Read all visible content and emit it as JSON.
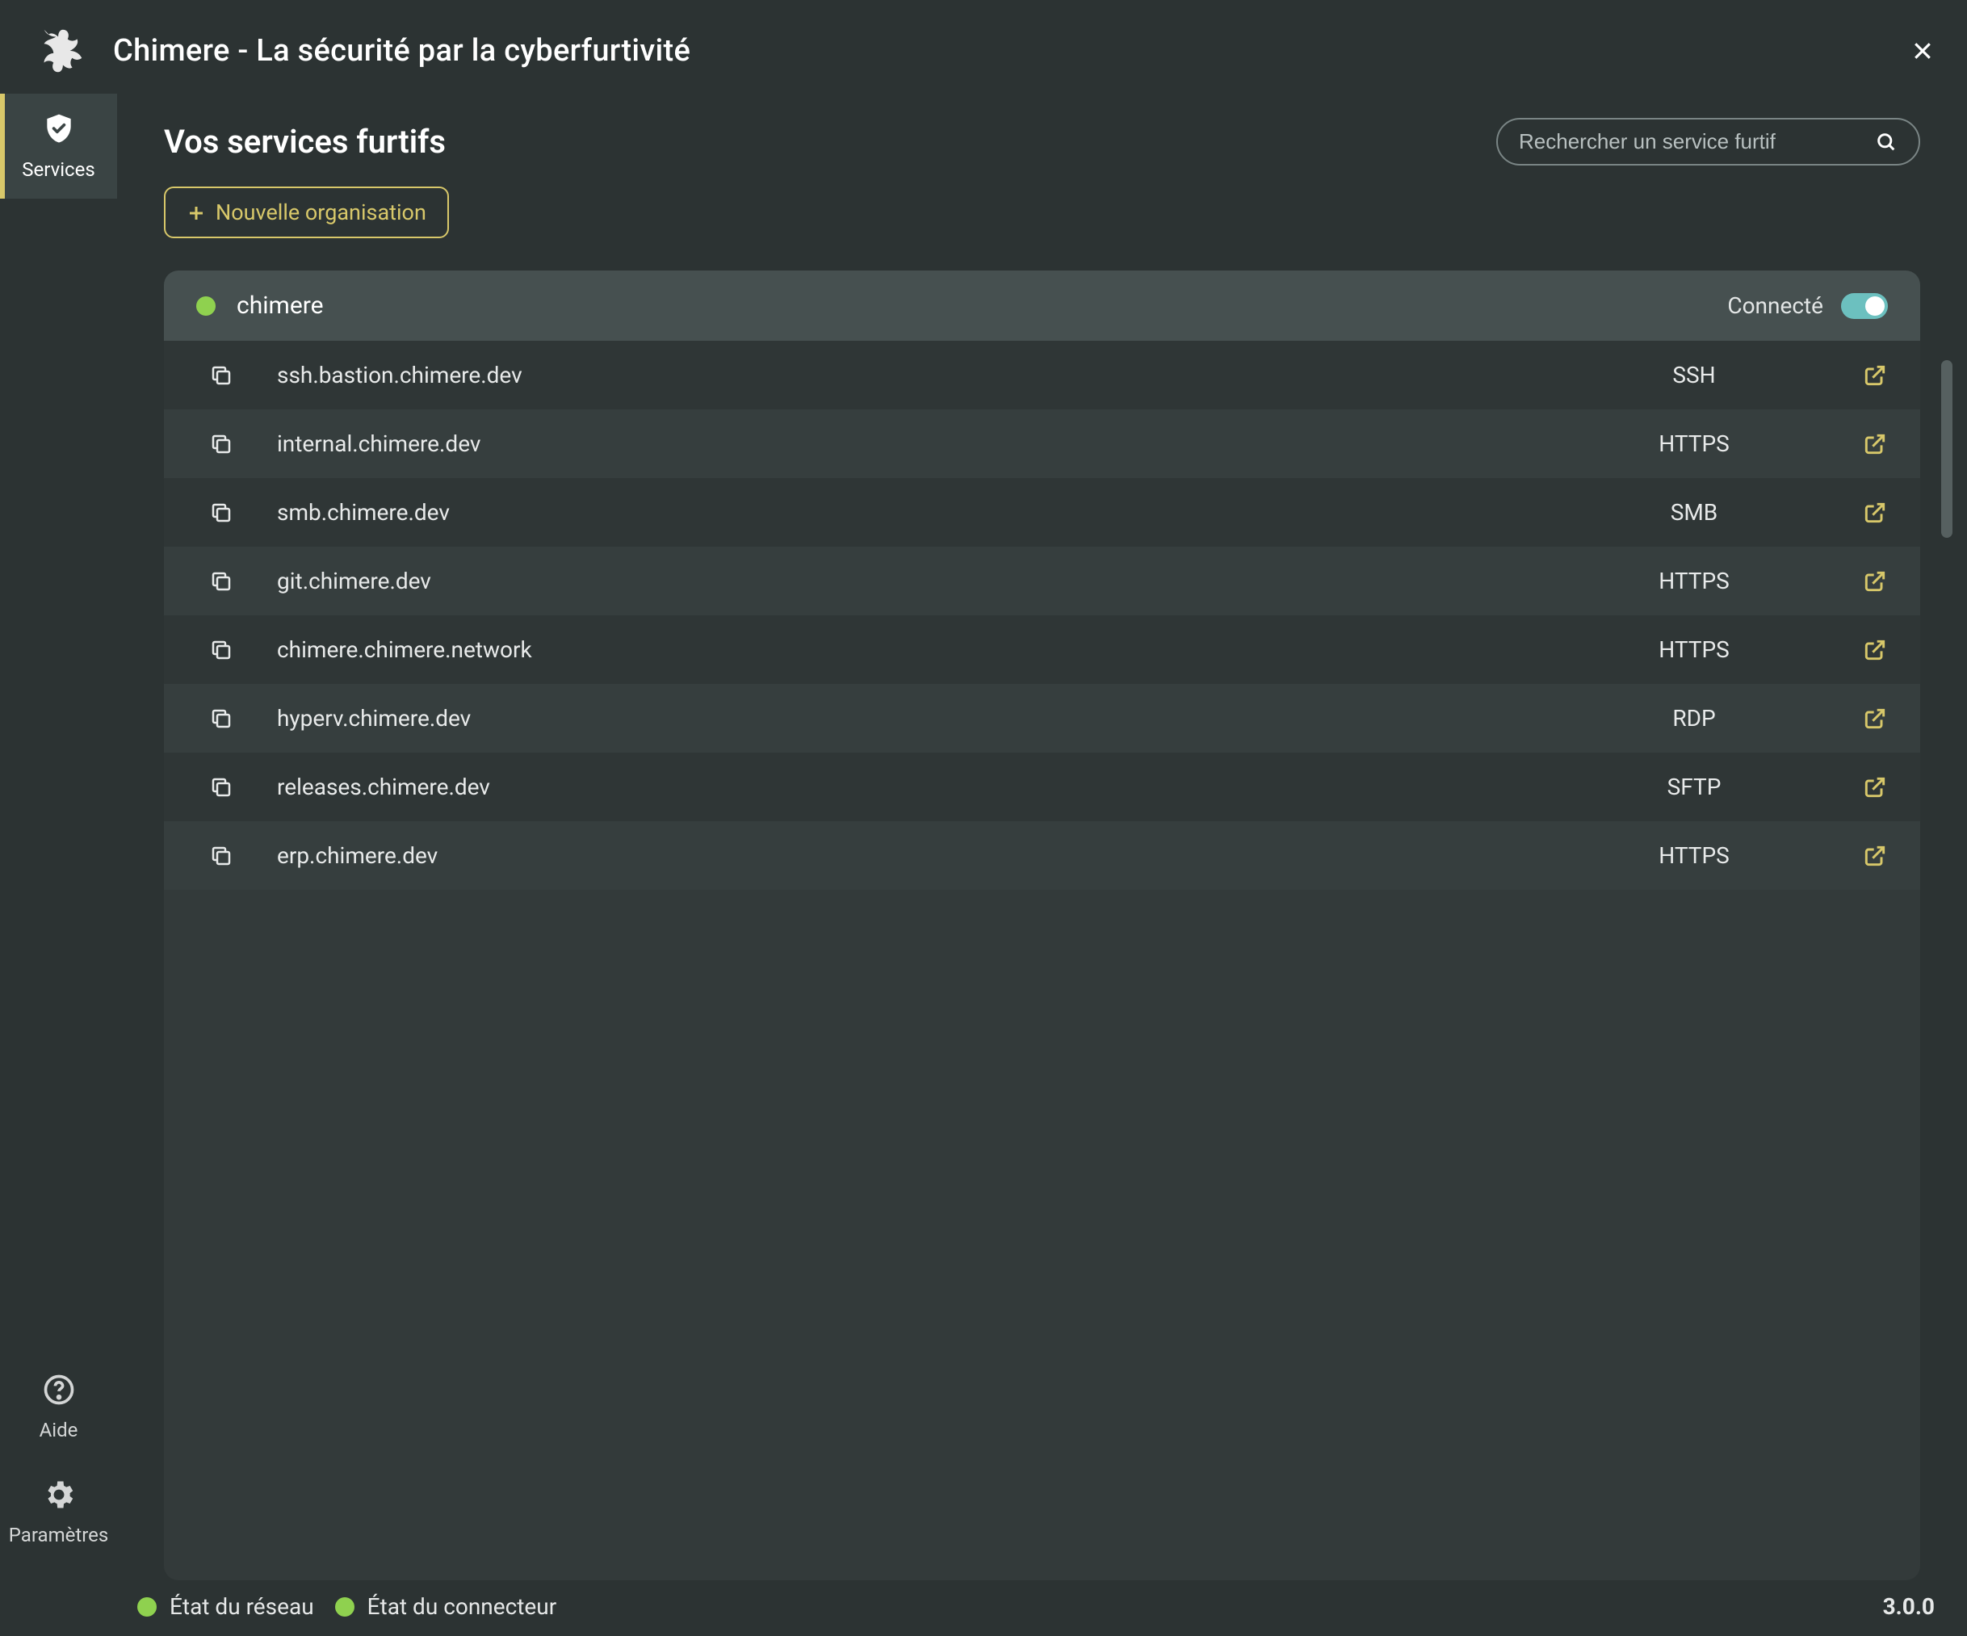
{
  "header": {
    "title": "Chimere - La sécurité par la cyberfurtivité"
  },
  "sidebar": {
    "top": [
      {
        "id": "services",
        "label": "Services",
        "active": true
      }
    ],
    "bottom": [
      {
        "id": "help",
        "label": "Aide"
      },
      {
        "id": "settings",
        "label": "Paramètres"
      }
    ]
  },
  "main": {
    "page_title": "Vos services furtifs",
    "search_placeholder": "Rechercher un service furtif",
    "new_org_label": "Nouvelle organisation",
    "organization": {
      "name": "chimere",
      "status_text": "Connecté",
      "connected": true
    },
    "services": [
      {
        "domain": "ssh.bastion.chimere.dev",
        "protocol": "SSH"
      },
      {
        "domain": "internal.chimere.dev",
        "protocol": "HTTPS"
      },
      {
        "domain": "smb.chimere.dev",
        "protocol": "SMB"
      },
      {
        "domain": "git.chimere.dev",
        "protocol": "HTTPS"
      },
      {
        "domain": "chimere.chimere.network",
        "protocol": "HTTPS"
      },
      {
        "domain": "hyperv.chimere.dev",
        "protocol": "RDP"
      },
      {
        "domain": "releases.chimere.dev",
        "protocol": "SFTP"
      },
      {
        "domain": "erp.chimere.dev",
        "protocol": "HTTPS"
      }
    ]
  },
  "footer": {
    "network_label": "État du réseau",
    "connector_label": "État du connecteur",
    "version": "3.0.0"
  },
  "colors": {
    "accent": "#d8c86a",
    "status_ok": "#8fd14f",
    "toggle_on": "#6cc0bf"
  }
}
